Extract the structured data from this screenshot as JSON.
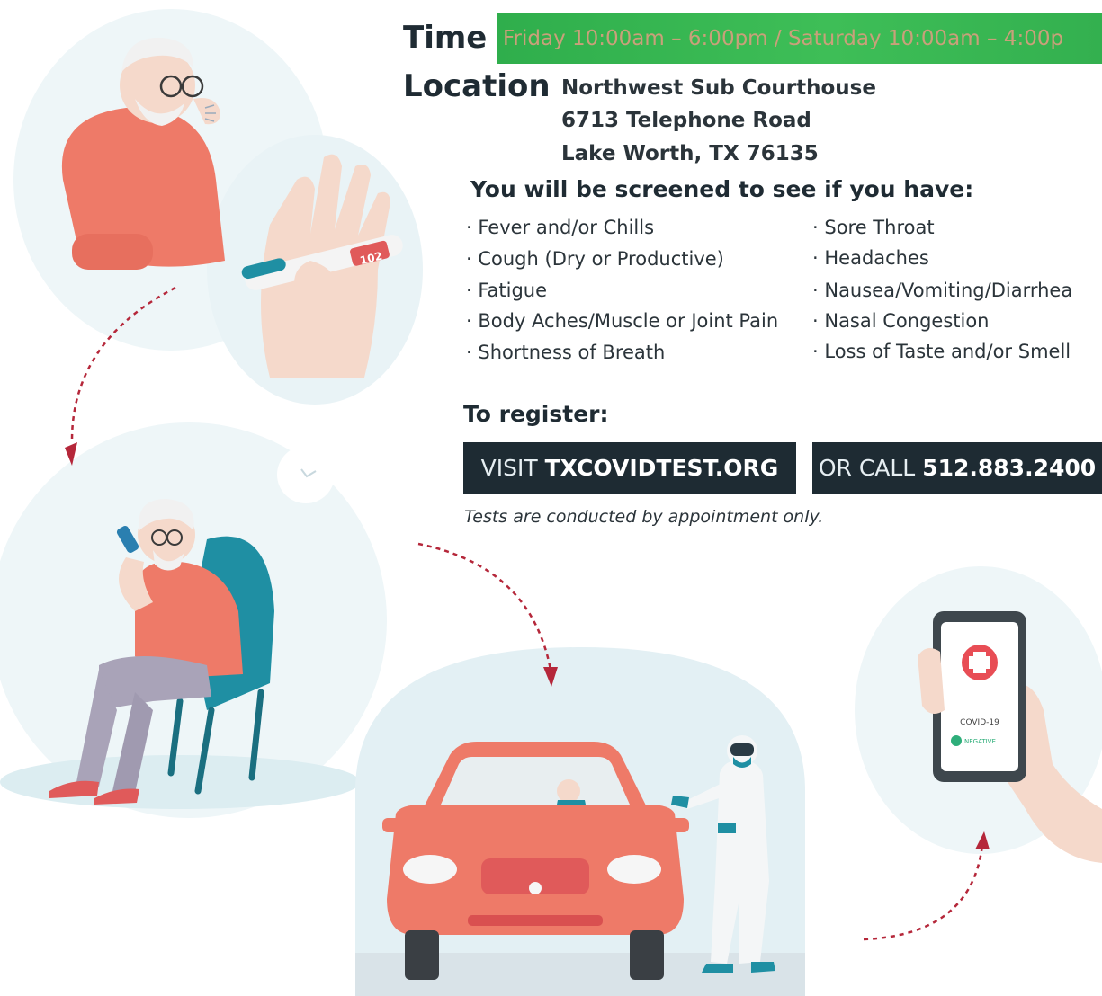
{
  "time": {
    "label": "Time",
    "value": "Friday 10:00am – 6:00pm / Saturday 10:00am – 4:00p"
  },
  "location": {
    "label": "Location",
    "line1": "Northwest Sub Courthouse",
    "line2": "6713 Telephone Road",
    "line3": "Lake Worth, TX 76135"
  },
  "screening": {
    "heading": "You will be screened to see if you have:",
    "left": [
      "Fever and/or Chills",
      "Cough (Dry or Productive)",
      "Fatigue",
      "Body Aches/Muscle or Joint Pain",
      "Shortness of Breath"
    ],
    "right": [
      "Sore Throat",
      "Headaches",
      "Nausea/Vomiting/Diarrhea",
      "Nasal Congestion",
      "Loss of Taste and/or Smell"
    ]
  },
  "register": {
    "heading": "To register:",
    "visit_prefix": "VISIT",
    "visit_site": "TXCOVIDTEST.ORG",
    "call_prefix": "OR CALL",
    "call_number": "512.883.2400",
    "note": "Tests are conducted by appointment only."
  },
  "illustrations": {
    "thermometer_reading": "102",
    "phone_result_title": "COVID-19",
    "phone_result_status": "NEGATIVE"
  },
  "colors": {
    "time_bar": "#3ebe57",
    "button_bg": "#1e2b33",
    "accent_red": "#b5273a",
    "shirt": "#ee7a68",
    "teal": "#1f8fa3"
  }
}
